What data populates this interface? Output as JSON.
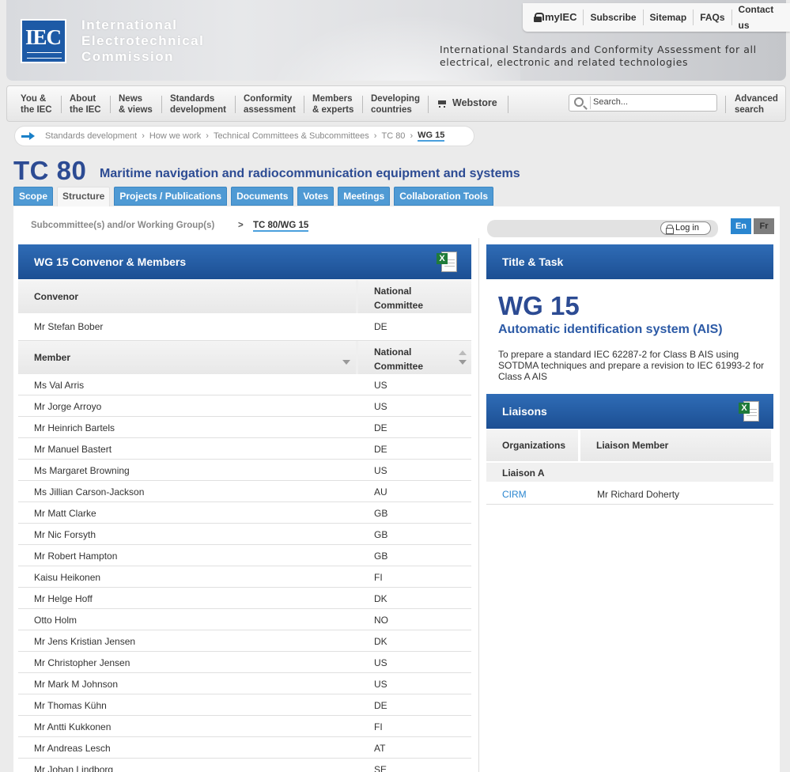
{
  "header": {
    "logo_text": "IEC",
    "org_name_lines": [
      "International",
      "Electrotechnical",
      "Commission"
    ],
    "tagline_line1": "International Standards and Conformity Assessment for all",
    "tagline_line2": "electrical, electronic and related technologies",
    "toplinks": [
      "myIEC",
      "Subscribe",
      "Sitemap",
      "FAQs",
      "Contact us"
    ]
  },
  "nav": {
    "items": [
      {
        "l1": "You &",
        "l2": "the IEC"
      },
      {
        "l1": "About",
        "l2": "the IEC"
      },
      {
        "l1": "News",
        "l2": "& views"
      },
      {
        "l1": "Standards",
        "l2": "development"
      },
      {
        "l1": "Conformity",
        "l2": "assessment"
      },
      {
        "l1": "Members",
        "l2": "& experts"
      },
      {
        "l1": "Developing",
        "l2": "countries"
      }
    ],
    "webstore": "Webstore",
    "search_placeholder": "Search...",
    "advanced_l1": "Advanced",
    "advanced_l2": "search"
  },
  "breadcrumb": [
    "Standards development",
    "How we work",
    "Technical Committees & Subcommittees",
    "TC 80",
    "WG 15"
  ],
  "page": {
    "title": "TC 80",
    "subtitle": "Maritime navigation and radiocommunication equipment and systems"
  },
  "tabs": [
    "Scope",
    "Structure",
    "Projects / Publications",
    "Documents",
    "Votes",
    "Meetings",
    "Collaboration Tools"
  ],
  "subnav": {
    "label": "Subcommittee(s) and/or Working Group(s)",
    "arrow": ">",
    "current": "TC 80/WG 15"
  },
  "login": "Log in",
  "languages": [
    "En",
    "Fr"
  ],
  "members_panel": {
    "title": "WG 15 Convenor & Members",
    "convenor_header": "Convenor",
    "nc_header_l1": "National",
    "nc_header_l2": "Committee",
    "convenor": {
      "name": "Mr Stefan Bober",
      "nc": "DE"
    },
    "member_header": "Member",
    "members": [
      {
        "name": "Ms Val Arris",
        "nc": "US"
      },
      {
        "name": "Mr Jorge Arroyo",
        "nc": "US"
      },
      {
        "name": "Mr Heinrich Bartels",
        "nc": "DE"
      },
      {
        "name": "Mr Manuel Bastert",
        "nc": "DE"
      },
      {
        "name": "Ms Margaret Browning",
        "nc": "US"
      },
      {
        "name": "Ms Jillian Carson-Jackson",
        "nc": "AU"
      },
      {
        "name": "Mr Matt Clarke",
        "nc": "GB"
      },
      {
        "name": "Mr Nic Forsyth",
        "nc": "GB"
      },
      {
        "name": "Mr Robert Hampton",
        "nc": "GB"
      },
      {
        "name": "Kaisu Heikonen",
        "nc": "FI"
      },
      {
        "name": "Mr Helge Hoff",
        "nc": "DK"
      },
      {
        "name": "Otto Holm",
        "nc": "NO"
      },
      {
        "name": "Mr Jens Kristian Jensen",
        "nc": "DK"
      },
      {
        "name": "Mr Christopher Jensen",
        "nc": "US"
      },
      {
        "name": "Mr Mark M Johnson",
        "nc": "US"
      },
      {
        "name": "Mr Thomas Kühn",
        "nc": "DE"
      },
      {
        "name": "Mr Antti Kukkonen",
        "nc": "FI"
      },
      {
        "name": "Mr Andreas Lesch",
        "nc": "AT"
      },
      {
        "name": "Mr Johan Lindborg",
        "nc": "SE"
      }
    ]
  },
  "title_task": {
    "header": "Title & Task",
    "wg": "WG 15",
    "title": "Automatic identification system (AIS)",
    "task": "To prepare a standard IEC 62287-2 for Class B AIS using SOTDMA techniques and prepare a revision to IEC 61993-2 for Class A AIS"
  },
  "liaisons": {
    "header": "Liaisons",
    "col1": "Organizations",
    "col2": "Liaison Member",
    "group": "Liaison A",
    "rows": [
      {
        "org": "CIRM",
        "member": "Mr Richard Doherty"
      }
    ]
  },
  "icons": [
    "lock-icon",
    "cart-icon",
    "search-icon",
    "arrow-right-icon",
    "excel-icon",
    "sort-icon"
  ]
}
